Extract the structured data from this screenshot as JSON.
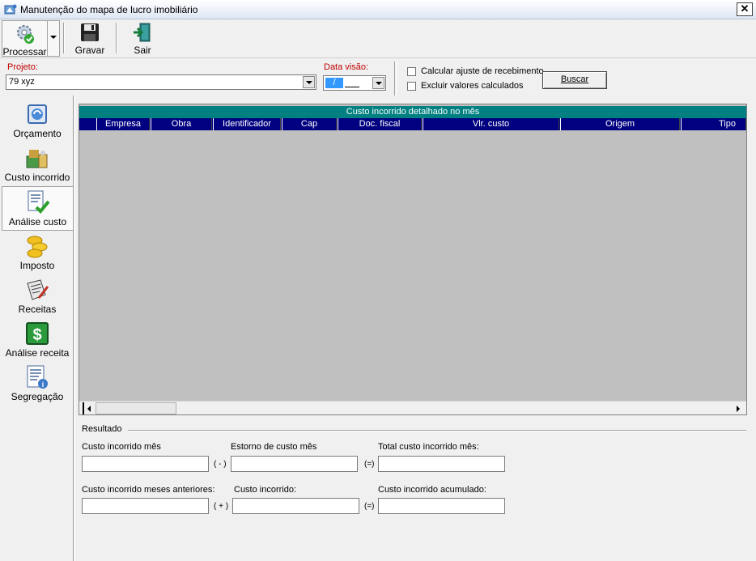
{
  "window": {
    "title": "Manutenção do mapa de lucro imobiliário",
    "close_glyph": "✕"
  },
  "toolbar": {
    "processar": "Processar",
    "gravar": "Gravar",
    "sair": "Sair"
  },
  "filters": {
    "projeto_label": "Projeto:",
    "projeto_value": "79  xyz",
    "data_label": "Data visão:",
    "data_value": "/",
    "calcular_ajuste_label": "Calcular ajuste de recebimento",
    "calcular_ajuste_checked": false,
    "excluir_valores_label": "Excluir valores calculados",
    "excluir_valores_checked": false,
    "buscar_label": "Buscar"
  },
  "sidebar": {
    "items": [
      {
        "label": "Orçamento",
        "icon": "budget-icon"
      },
      {
        "label": "Custo incorrido",
        "icon": "incurred-cost-icon"
      },
      {
        "label": "Análise custo",
        "icon": "cost-analysis-icon",
        "active": true
      },
      {
        "label": "Imposto",
        "icon": "tax-coins-icon"
      },
      {
        "label": "Receitas",
        "icon": "receipts-icon"
      },
      {
        "label": "Análise receita",
        "icon": "revenue-analysis-icon"
      },
      {
        "label": "Segregação",
        "icon": "segregation-icon"
      }
    ]
  },
  "grid": {
    "group_header": "Custo incorrido detalhado no mês",
    "columns": [
      "Empresa",
      "Obra",
      "Identificador",
      "Cap",
      "Doc. fiscal",
      "Vlr. custo",
      "Origem",
      "Tipo"
    ],
    "rows": []
  },
  "resultado": {
    "title": "Resultado",
    "row1": {
      "a_label": "Custo incorrido mês",
      "a_value": "",
      "op1": "( - )",
      "b_label": "Estorno de custo mês",
      "b_value": "",
      "op2": "(=)",
      "c_label": "Total custo incorrido mês:",
      "c_value": ""
    },
    "row2": {
      "a_label": "Custo incorrido meses anteriores:",
      "a_value": "",
      "op1": "( + )",
      "b_label": "Custo incorrido:",
      "b_value": "",
      "op2": "(=)",
      "c_label": "Custo incorrido acumulado:",
      "c_value": ""
    }
  }
}
